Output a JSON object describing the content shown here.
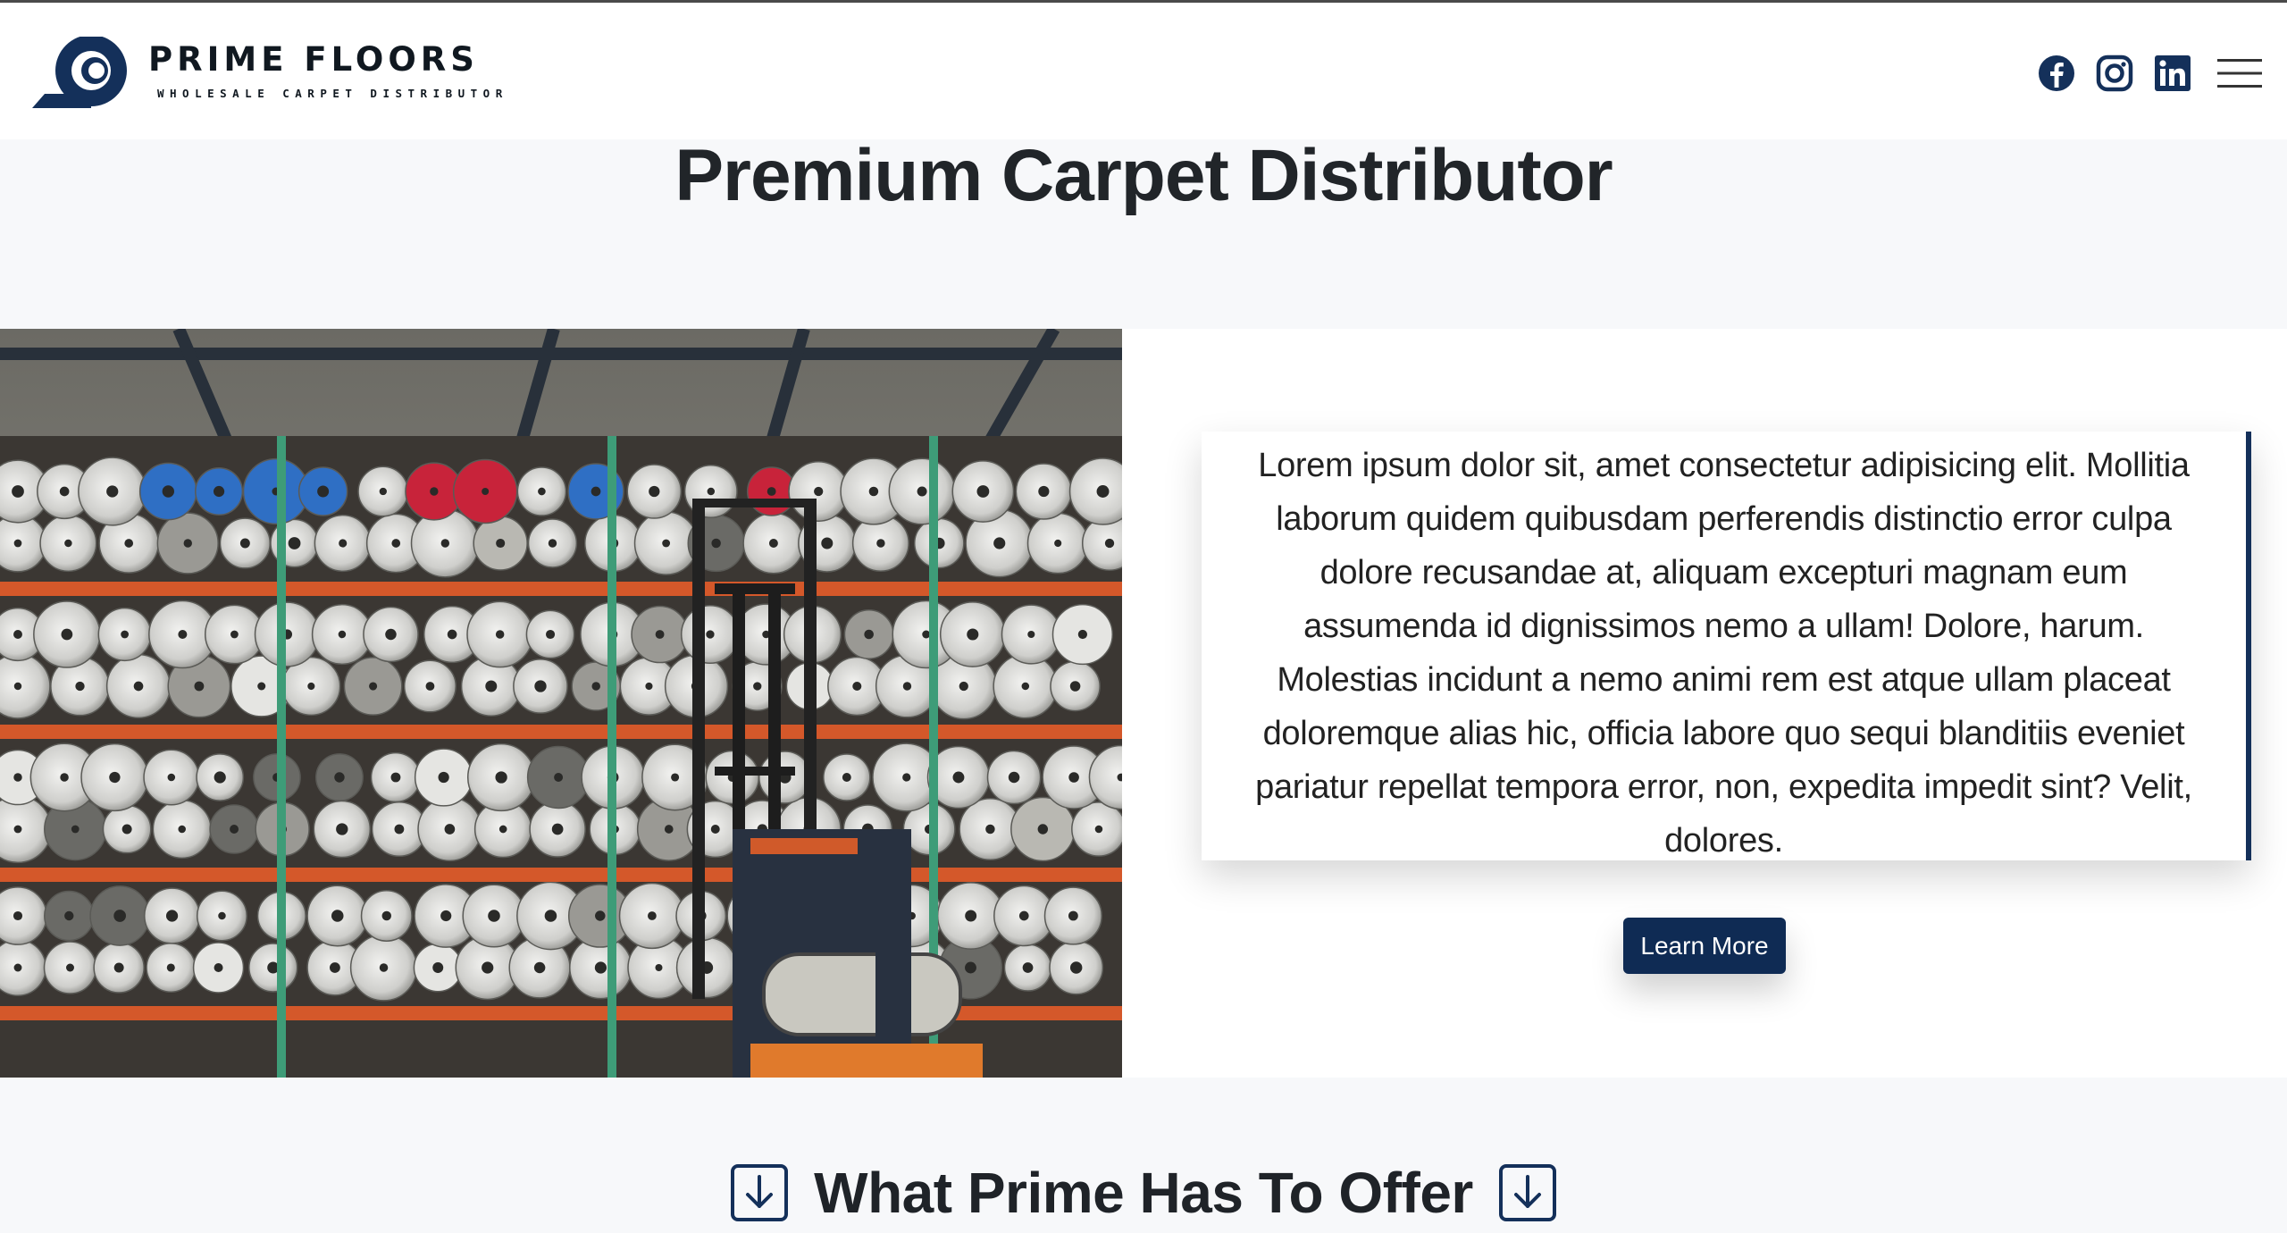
{
  "brand": {
    "name": "PRIME FLOORS",
    "tagline": "WHOLESALE CARPET DISTRIBUTOR"
  },
  "nav": {
    "social": [
      "facebook-icon",
      "instagram-icon",
      "linkedin-icon"
    ],
    "menu_icon": "hamburger-menu-icon"
  },
  "hero": {
    "title": "Premium Carpet Distributor"
  },
  "feature": {
    "image_subject": "warehouse shelves of carpet rolls with forklift",
    "body": "Lorem ipsum dolor sit, amet consectetur adipisicing elit. Mollitia laborum quidem quibusdam perferendis distinctio error culpa dolore recusandae at, aliquam excepturi magnam eum assumenda id dignissimos nemo a ullam! Dolore, harum. Molestias incidunt a nemo animi rem est atque ullam placeat doloremque alias hic, officia labore quo sequi blanditiis eveniet pariatur repellat tempora error, non, expedita impedit sint? Velit, dolores.",
    "button_label": "Learn More"
  },
  "offer": {
    "title": "What Prime Has To Offer",
    "icon": "arrow-down-square-icon"
  },
  "colors": {
    "brand_navy": "#0f2b54",
    "accent_border": "#14305a",
    "page_bg": "#f7f8fa",
    "text_dark": "#212529"
  }
}
